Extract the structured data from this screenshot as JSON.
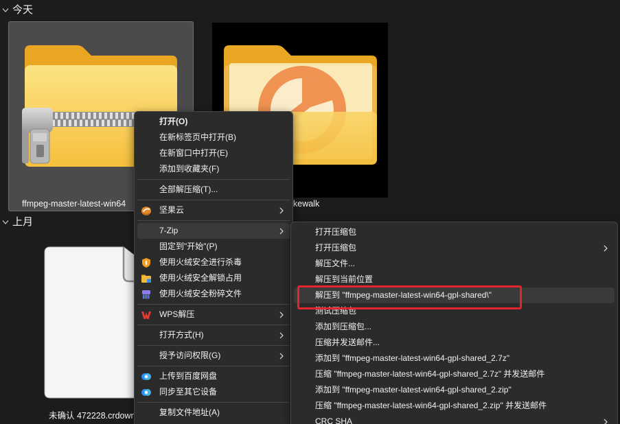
{
  "explorer": {
    "groups": [
      {
        "label": "今天",
        "icon": "chevron-down-icon"
      },
      {
        "label": "上月",
        "icon": "chevron-down-icon"
      }
    ],
    "files": [
      {
        "label": "ffmpeg-master-latest-win64",
        "icon": "zip-folder-icon",
        "selected": true
      },
      {
        "label": "kewalk",
        "icon": "cakewalk-folder-icon",
        "selected": false
      },
      {
        "label": "未确认 472228.crdown",
        "icon": "blank-file-icon",
        "selected": false
      }
    ]
  },
  "context_menu": {
    "items": [
      {
        "label": "打开(O)",
        "bold": true
      },
      {
        "label": "在新标签页中打开(B)"
      },
      {
        "label": "在新窗口中打开(E)"
      },
      {
        "label": "添加到收藏夹(F)"
      },
      {
        "label": "全部解压缩(T)..."
      },
      {
        "label": "坚果云",
        "icon": "nutstore-icon",
        "has_submenu": true
      },
      {
        "label": "7-Zip",
        "has_submenu": true,
        "highlighted": true
      },
      {
        "label": "固定到\"开始\"(P)"
      },
      {
        "label": "使用火绒安全进行杀毒",
        "icon": "huorong-shield-icon"
      },
      {
        "label": "使用火绒安全解锁占用",
        "icon": "huorong-unlock-icon"
      },
      {
        "label": "使用火绒安全粉碎文件",
        "icon": "huorong-shred-icon"
      },
      {
        "label": "WPS解压",
        "icon": "wps-icon",
        "has_submenu": true
      },
      {
        "label": "打开方式(H)",
        "has_submenu": true
      },
      {
        "label": "授予访问权限(G)",
        "has_submenu": true
      },
      {
        "label": "上传到百度网盘",
        "icon": "baidu-netdisk-icon"
      },
      {
        "label": "同步至其它设备",
        "icon": "baidu-netdisk-icon"
      },
      {
        "label": "复制文件地址(A)"
      }
    ]
  },
  "zip_submenu": {
    "items": [
      {
        "label": "打开压缩包"
      },
      {
        "label": "打开压缩包",
        "has_submenu": true
      },
      {
        "label": "解压文件..."
      },
      {
        "label": "解压到当前位置"
      },
      {
        "label": "解压到 \"ffmpeg-master-latest-win64-gpl-shared\\\"",
        "highlighted": true
      },
      {
        "label": "测试压缩包"
      },
      {
        "label": "添加到压缩包..."
      },
      {
        "label": "压缩并发送邮件..."
      },
      {
        "label": "添加到 \"ffmpeg-master-latest-win64-gpl-shared_2.7z\""
      },
      {
        "label": "压缩 \"ffmpeg-master-latest-win64-gpl-shared_2.7z\" 并发送邮件"
      },
      {
        "label": "添加到 \"ffmpeg-master-latest-win64-gpl-shared_2.zip\""
      },
      {
        "label": "压缩 \"ffmpeg-master-latest-win64-gpl-shared_2.zip\" 并发送邮件"
      },
      {
        "label": "CRC SHA",
        "has_submenu": true
      }
    ]
  },
  "colors": {
    "window_background": "#1c1c1c",
    "menu_background": "#2b2b2b",
    "menu_hover": "#3a3a3a",
    "selection": "#4b4b4b",
    "annotation_box": "#e3262c",
    "folder_yellow": "#f7c94f",
    "cakewalk_orange": "#ec7a2d"
  }
}
